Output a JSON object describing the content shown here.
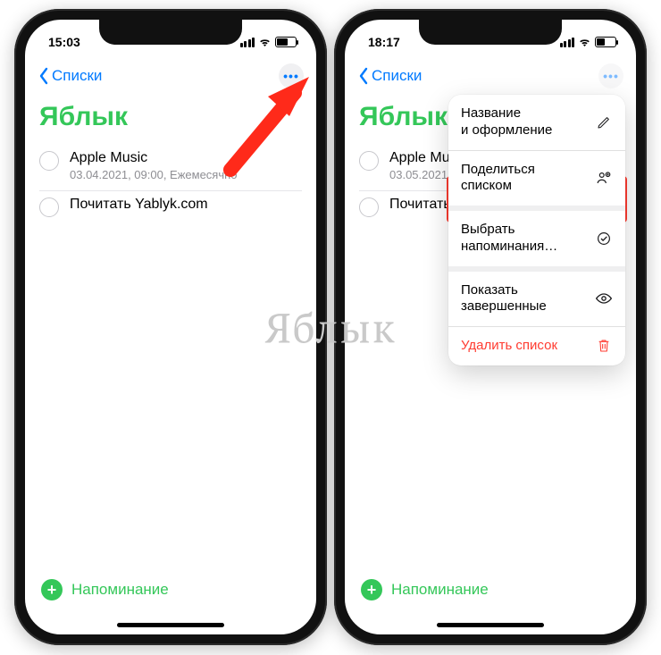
{
  "watermark": "Яблык",
  "phones": {
    "left": {
      "status": {
        "time": "15:03",
        "battery_fill_pct": 55
      },
      "nav": {
        "back_label": "Списки"
      },
      "list_title": "Яблык",
      "reminders": [
        {
          "title": "Apple Music",
          "subtitle": "03.04.2021, 09:00, Ежемесячно"
        },
        {
          "title": "Почитать Yablyk.com",
          "subtitle": ""
        }
      ],
      "add_label": "Напоминание"
    },
    "right": {
      "status": {
        "time": "18:17",
        "battery_fill_pct": 40
      },
      "nav": {
        "back_label": "Списки"
      },
      "list_title": "Яблык",
      "reminders": [
        {
          "title": "Apple Music",
          "subtitle": "03.05.2021, 09:00, Ежемесячно"
        },
        {
          "title": "Почитать Yablyk.com",
          "subtitle": ""
        }
      ],
      "add_label": "Напоминание",
      "menu": {
        "items": [
          {
            "label": "Название\nи оформление",
            "icon": "pencil"
          },
          {
            "label": "Поделиться списком",
            "icon": "share-person"
          },
          {
            "label": "Выбрать\nнапоминания…",
            "icon": "check-circle",
            "highlighted": true
          },
          {
            "label": "Показать завершенные",
            "icon": "eye"
          },
          {
            "label": "Удалить список",
            "icon": "trash",
            "danger": true
          }
        ]
      }
    }
  }
}
